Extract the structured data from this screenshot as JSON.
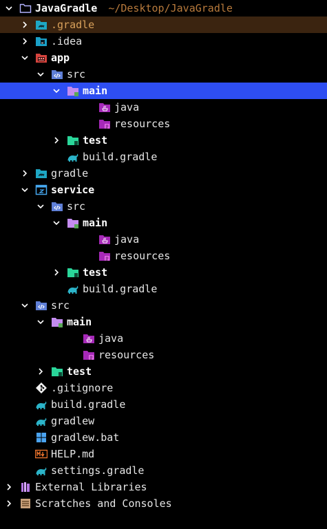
{
  "tree": [
    {
      "label": "JavaGradle",
      "path": "~/Desktop/JavaGradle",
      "bold": true,
      "icon": "project-folder-icon",
      "chevron": "down",
      "name": "root-javagradle"
    },
    {
      "label": ".gradle",
      "icon": "gradle-folder-icon",
      "chevron": "right",
      "name": "folder-dot-gradle",
      "highlight": "gradle"
    },
    {
      "label": ".idea",
      "icon": "idea-folder-icon",
      "chevron": "right",
      "name": "folder-idea"
    },
    {
      "label": "app",
      "bold": true,
      "icon": "module-folder-icon",
      "chevron": "down",
      "name": "module-app"
    },
    {
      "label": "src",
      "icon": "source-folder-icon",
      "chevron": "down",
      "name": "app-src"
    },
    {
      "label": "main",
      "bold": true,
      "icon": "main-folder-icon",
      "chevron": "down",
      "name": "app-src-main",
      "selected": true
    },
    {
      "label": "java",
      "icon": "java-folder-icon",
      "chevron": "none",
      "name": "app-src-main-java"
    },
    {
      "label": "resources",
      "icon": "resources-folder-icon",
      "chevron": "none",
      "name": "app-src-main-resources"
    },
    {
      "label": "test",
      "bold": true,
      "icon": "test-folder-icon",
      "chevron": "right",
      "name": "app-src-test"
    },
    {
      "label": "build.gradle",
      "icon": "gradle-file-icon",
      "chevron": "none",
      "name": "app-build-gradle"
    },
    {
      "label": "gradle",
      "icon": "gradle-folder-icon",
      "chevron": "right",
      "name": "folder-gradle"
    },
    {
      "label": "service",
      "bold": true,
      "icon": "service-module-icon",
      "chevron": "down",
      "name": "module-service"
    },
    {
      "label": "src",
      "icon": "source-folder-icon",
      "chevron": "down",
      "name": "service-src"
    },
    {
      "label": "main",
      "bold": true,
      "icon": "main-folder-icon",
      "chevron": "down",
      "name": "service-src-main"
    },
    {
      "label": "java",
      "icon": "java-folder-icon",
      "chevron": "none",
      "name": "service-src-main-java"
    },
    {
      "label": "resources",
      "icon": "resources-folder-icon",
      "chevron": "none",
      "name": "service-src-main-resources"
    },
    {
      "label": "test",
      "bold": true,
      "icon": "test-folder-icon",
      "chevron": "right",
      "name": "service-src-test"
    },
    {
      "label": "build.gradle",
      "icon": "gradle-file-icon",
      "chevron": "none",
      "name": "service-build-gradle"
    },
    {
      "label": "src",
      "icon": "source-folder-icon",
      "chevron": "down",
      "name": "root-src"
    },
    {
      "label": "main",
      "bold": true,
      "icon": "main-folder-icon",
      "chevron": "down",
      "name": "root-src-main"
    },
    {
      "label": "java",
      "icon": "java-folder-icon",
      "chevron": "none",
      "name": "root-src-main-java"
    },
    {
      "label": "resources",
      "icon": "resources-folder-icon",
      "chevron": "none",
      "name": "root-src-main-resources"
    },
    {
      "label": "test",
      "bold": true,
      "icon": "test-folder-icon",
      "chevron": "right",
      "name": "root-src-test"
    },
    {
      "label": ".gitignore",
      "icon": "git-file-icon",
      "chevron": "none",
      "name": "file-gitignore"
    },
    {
      "label": "build.gradle",
      "icon": "gradle-file-icon",
      "chevron": "none",
      "name": "file-build-gradle"
    },
    {
      "label": "gradlew",
      "icon": "gradle-file-icon",
      "chevron": "none",
      "name": "file-gradlew"
    },
    {
      "label": "gradlew.bat",
      "icon": "windows-file-icon",
      "chevron": "none",
      "name": "file-gradlew-bat"
    },
    {
      "label": "HELP.md",
      "icon": "markdown-file-icon",
      "chevron": "none",
      "name": "file-help-md"
    },
    {
      "label": "settings.gradle",
      "icon": "gradle-file-icon",
      "chevron": "none",
      "name": "file-settings-gradle"
    },
    {
      "label": "External Libraries",
      "icon": "libraries-icon",
      "chevron": "right",
      "name": "external-libraries"
    },
    {
      "label": "Scratches and Consoles",
      "icon": "scratches-icon",
      "chevron": "right",
      "name": "scratches-and-consoles"
    }
  ]
}
